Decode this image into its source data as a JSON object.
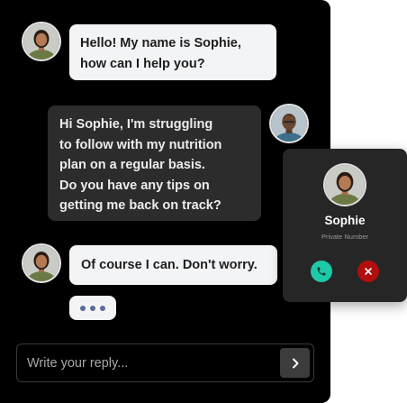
{
  "colors": {
    "panel_bg": "#000000",
    "bubble_light": "#f3f4f6",
    "bubble_dark": "#2c2c2c",
    "accept": "#1ec9a8",
    "decline": "#b10e0e",
    "typing_dots": "#5a6d9a"
  },
  "chat": {
    "messages": [
      {
        "sender": "agent",
        "avatar_icon": "woman-avatar-icon",
        "lines": [
          "Hello! My name is Sophie,",
          "how can I help you?"
        ]
      },
      {
        "sender": "user",
        "avatar_icon": "man-avatar-icon",
        "lines": [
          "Hi Sophie, I'm struggling",
          "to follow with my nutrition",
          "plan on a regular basis.",
          "Do you have any tips on",
          "getting me back on track?"
        ]
      },
      {
        "sender": "agent",
        "avatar_icon": "woman-avatar-icon",
        "lines": [
          "Of course I can. Don't worry."
        ]
      }
    ],
    "typing_indicator_icon": "ellipsis-icon"
  },
  "composer": {
    "placeholder": "Write your reply...",
    "send_icon": "chevron-right-icon"
  },
  "call": {
    "name": "Sophie",
    "subtitle": "Private Number",
    "accept_icon": "phone-icon",
    "decline_icon": "close-icon"
  }
}
